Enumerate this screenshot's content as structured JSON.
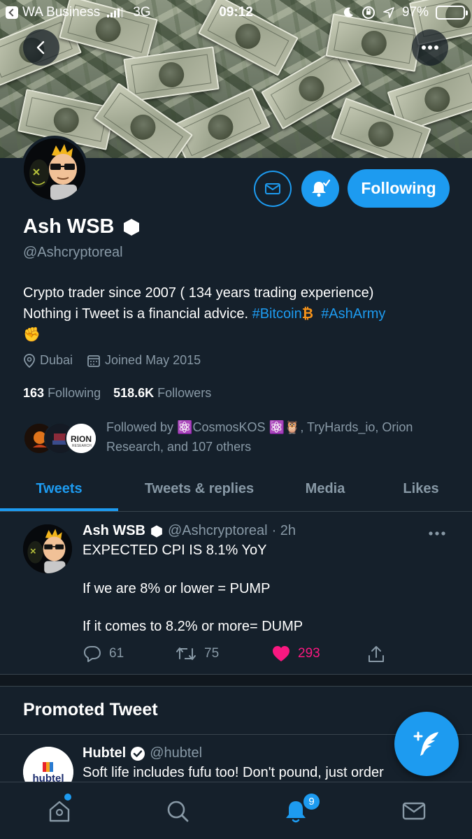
{
  "status_bar": {
    "back_app": "WA Business",
    "network": "3G",
    "time": "09:12",
    "battery": "97%",
    "battery_level": 0.97
  },
  "profile": {
    "name": "Ash WSB",
    "handle": "@Ashcryptoreal",
    "bio_line1": "Crypto trader since 2007 ( 134 years trading experience)",
    "bio_line2_text": "Nothing i Tweet is a financial advice. ",
    "bio_hashtag1": "#Bitcoin",
    "bio_bitcoin_emoji": "₿",
    "bio_hashtag2": "#AshArmy",
    "bio_emoji": "✊",
    "location": "Dubai",
    "joined": "Joined May 2015",
    "following_count": "163",
    "following_label": "Following",
    "followers_count": "518.6K",
    "followers_label": "Followers",
    "followed_by": "Followed by ⚛️CosmosKOS ⚛️🦉, TryHards_io, Orion Research, and 107 others",
    "follow_button": "Following"
  },
  "tabs": [
    {
      "label": "Tweets",
      "active": true
    },
    {
      "label": "Tweets & replies",
      "active": false
    },
    {
      "label": "Media",
      "active": false
    },
    {
      "label": "Likes",
      "active": false
    }
  ],
  "tweet": {
    "name": "Ash WSB",
    "handle": "@Ashcryptoreal",
    "time": "· 2h",
    "line1": "EXPECTED CPI IS 8.1% YoY",
    "line2": "If we are 8% or lower = PUMP",
    "line3": "If it comes to 8.2% or more= DUMP",
    "replies": "61",
    "retweets": "75",
    "likes": "293"
  },
  "promoted": {
    "title": "Promoted Tweet",
    "name": "Hubtel",
    "handle": "@hubtel",
    "text": "Soft life includes fufu too! Don't pound, just order",
    "logo_text": "hubtel"
  },
  "bottom_nav": {
    "notifications_badge": "9"
  },
  "colors": {
    "background": "#15202b",
    "accent": "#1d9bf0",
    "muted": "#8899a6",
    "like": "#f91880"
  }
}
